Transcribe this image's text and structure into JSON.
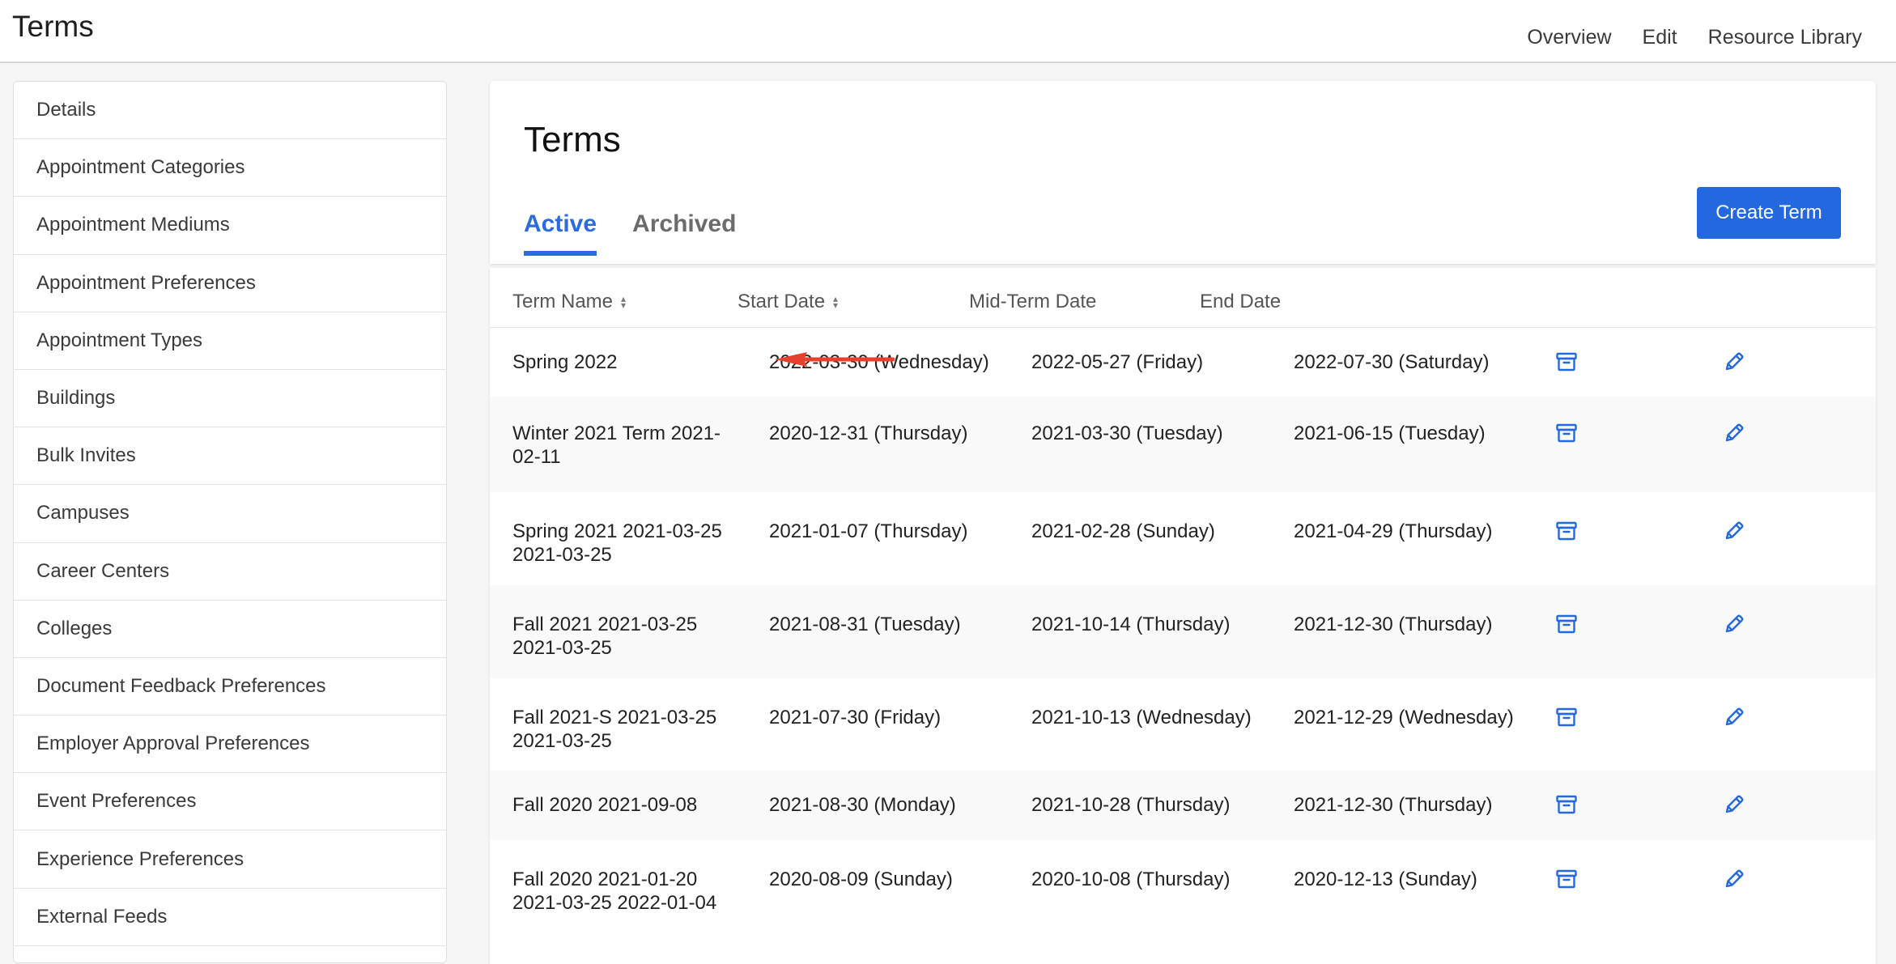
{
  "header": {
    "title": "Terms",
    "nav": [
      "Overview",
      "Edit",
      "Resource Library"
    ]
  },
  "sidebar": {
    "items": [
      "Details",
      "Appointment Categories",
      "Appointment Mediums",
      "Appointment Preferences",
      "Appointment Types",
      "Buildings",
      "Bulk Invites",
      "Campuses",
      "Career Centers",
      "Colleges",
      "Document Feedback Preferences",
      "Employer Approval Preferences",
      "Event Preferences",
      "Experience Preferences",
      "External Feeds"
    ]
  },
  "main": {
    "title": "Terms",
    "tabs": [
      {
        "label": "Active",
        "active": true
      },
      {
        "label": "Archived",
        "active": false
      }
    ],
    "create_button": "Create Term"
  },
  "table": {
    "columns": [
      "Term Name",
      "Start Date",
      "Mid-Term Date",
      "End Date"
    ],
    "rows": [
      {
        "name": "Spring 2022",
        "start": "2022-03-30 (Wednesday)",
        "mid": "2022-05-27 (Friday)",
        "end": "2022-07-30 (Saturday)"
      },
      {
        "name": "Winter 2021 Term 2021-\n02-11",
        "start": "2020-12-31 (Thursday)",
        "mid": "2021-03-30 (Tuesday)",
        "end": "2021-06-15 (Tuesday)"
      },
      {
        "name": "Spring 2021 2021-03-25\n2021-03-25",
        "start": "2021-01-07 (Thursday)",
        "mid": "2021-02-28 (Sunday)",
        "end": "2021-04-29 (Thursday)"
      },
      {
        "name": "Fall 2021 2021-03-25\n2021-03-25",
        "start": "2021-08-31 (Tuesday)",
        "mid": "2021-10-14 (Thursday)",
        "end": "2021-12-30 (Thursday)"
      },
      {
        "name": "Fall 2021-S 2021-03-25\n2021-03-25",
        "start": "2021-07-30 (Friday)",
        "mid": "2021-10-13 (Wednesday)",
        "end": "2021-12-29 (Wednesday)"
      },
      {
        "name": "Fall 2020 2021-09-08",
        "start": "2021-08-30 (Monday)",
        "mid": "2021-10-28 (Thursday)",
        "end": "2021-12-30 (Thursday)"
      },
      {
        "name": "Fall 2020 2021-01-20\n2021-03-25 2022-01-04",
        "start": "2020-08-09 (Sunday)",
        "mid": "2020-10-08 (Thursday)",
        "end": "2020-12-13 (Sunday)"
      }
    ]
  },
  "colors": {
    "accent": "#2468e0",
    "annotation": "#e8402f"
  },
  "icons": {
    "archive": "archive-box-icon",
    "edit": "pencil-icon",
    "sort": "sort-icon"
  }
}
